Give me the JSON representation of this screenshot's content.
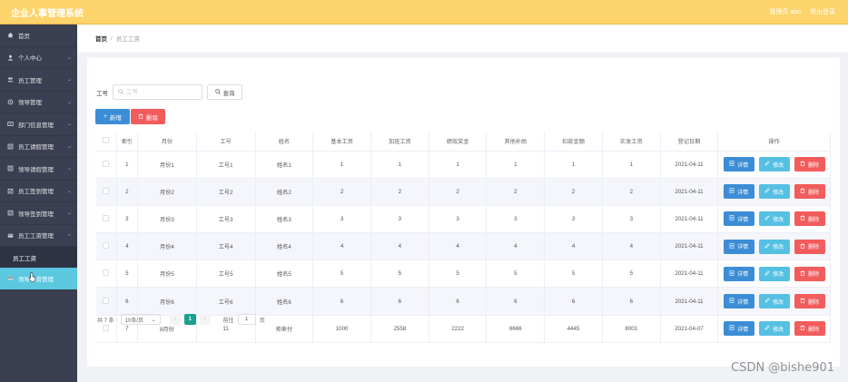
{
  "app": {
    "title": "企业人事管理系统"
  },
  "topbar": {
    "user": "管理员 abo",
    "logout": "退出登录"
  },
  "sidebar": {
    "items": [
      {
        "label": "首页",
        "icon": "home-icon",
        "chevron": false
      },
      {
        "label": "个人中心",
        "icon": "user-icon",
        "chevron": true
      },
      {
        "label": "员工管理",
        "icon": "users-icon",
        "chevron": true
      },
      {
        "label": "领导管理",
        "icon": "settings-icon",
        "chevron": true
      },
      {
        "label": "部门信息管理",
        "icon": "dept-icon",
        "chevron": true
      },
      {
        "label": "员工请假管理",
        "icon": "leave-icon",
        "chevron": true
      },
      {
        "label": "领导请假管理",
        "icon": "leave-icon",
        "chevron": true
      },
      {
        "label": "员工签到管理",
        "icon": "signin-icon",
        "chevron": true
      },
      {
        "label": "领导签到管理",
        "icon": "signin-icon",
        "chevron": true
      },
      {
        "label": "员工工资管理",
        "icon": "salary-icon",
        "chevron": true
      }
    ],
    "subitem": "员工工资",
    "active": {
      "label": "领导工资管理",
      "icon": "salary-icon"
    }
  },
  "breadcrumb": {
    "home": "首页",
    "separator": "/",
    "current": "员工工资"
  },
  "search": {
    "label": "工号",
    "placeholder": "工号",
    "button": "查询"
  },
  "actions": {
    "add": "新增",
    "delete": "删除"
  },
  "table": {
    "headers": [
      "索引",
      "月份",
      "工号",
      "姓名",
      "基本工资",
      "加班工资",
      "绩效奖金",
      "其他补助",
      "扣款金额",
      "实发工资",
      "登记日期",
      "操作"
    ],
    "rows": [
      [
        "1",
        "月份1",
        "工号1",
        "姓名1",
        "1",
        "1",
        "1",
        "1",
        "1",
        "1",
        "2021-04-11"
      ],
      [
        "2",
        "月份2",
        "工号2",
        "姓名2",
        "2",
        "2",
        "2",
        "2",
        "2",
        "2",
        "2021-04-11"
      ],
      [
        "3",
        "月份3",
        "工号3",
        "姓名3",
        "3",
        "3",
        "3",
        "3",
        "3",
        "3",
        "2021-04-11"
      ],
      [
        "4",
        "月份4",
        "工号4",
        "姓名4",
        "4",
        "4",
        "4",
        "4",
        "4",
        "4",
        "2021-04-11"
      ],
      [
        "5",
        "月份5",
        "工号5",
        "姓名5",
        "5",
        "5",
        "5",
        "5",
        "5",
        "5",
        "2021-04-11"
      ],
      [
        "6",
        "月份6",
        "工号6",
        "姓名6",
        "6",
        "6",
        "6",
        "6",
        "6",
        "6",
        "2021-04-11"
      ],
      [
        "7",
        "8月份",
        "11",
        "帅来付",
        "1000",
        "2558",
        "2222",
        "6666",
        "4445",
        "8001",
        "2021-04-07"
      ]
    ],
    "ops": {
      "detail": "详情",
      "edit": "修改",
      "delete": "删除"
    }
  },
  "pagination": {
    "total": "共 7 条",
    "page_size": "10条/页",
    "current_page": "1",
    "goto_label": "前往",
    "goto_value": "1",
    "page_suffix": "页"
  },
  "watermark": "CSDN @bishe901",
  "colors": {
    "topbar": "#fdd46b",
    "sidebar": "#3a3f51",
    "active": "#5bc8e0",
    "primary": "#3c8dd6",
    "danger": "#f25c5c",
    "info": "#55c0e3",
    "page_active": "#1aa08c"
  }
}
